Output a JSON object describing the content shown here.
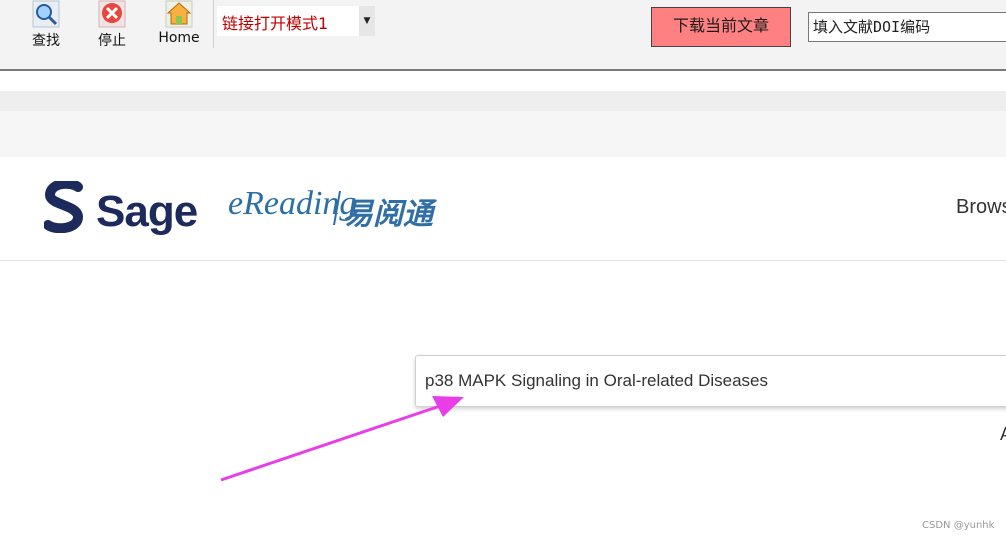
{
  "toolbar": {
    "find_label": "查找",
    "stop_label": "停止",
    "home_label": "Home",
    "mode_select_value": "链接打开模式1",
    "download_label": "下载当前文章",
    "doi_placeholder": "填入文献DOI编码"
  },
  "site": {
    "brand_name": "Sage",
    "partner_latin": "eReading",
    "partner_cn": "易阅通",
    "nav_browse": "Brows"
  },
  "search": {
    "value": "p38 MAPK Signaling in Oral-related Diseases",
    "fragment": "A"
  },
  "watermark": "CSDN @yunhk",
  "colors": {
    "download_bg": "#ff8080",
    "mode_text": "#c00000",
    "sage_navy": "#1c2a5c",
    "arrow": "#e83ee8"
  }
}
